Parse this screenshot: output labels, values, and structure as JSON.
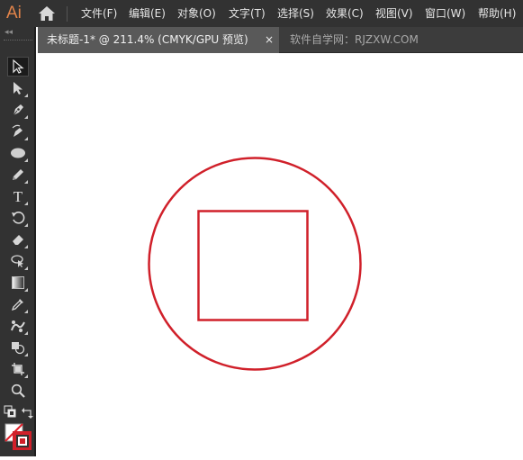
{
  "app": {
    "logo_text": "Ai",
    "brand_color": "#e2844a"
  },
  "menu": {
    "items": [
      {
        "label": "文件(F)"
      },
      {
        "label": "编辑(E)"
      },
      {
        "label": "对象(O)"
      },
      {
        "label": "文字(T)"
      },
      {
        "label": "选择(S)"
      },
      {
        "label": "效果(C)"
      },
      {
        "label": "视图(V)"
      },
      {
        "label": "窗口(W)"
      },
      {
        "label": "帮助(H)"
      }
    ]
  },
  "tabs": {
    "active": {
      "label": "未标题-1* @ 211.4% (CMYK/GPU 预览)",
      "close": "×"
    },
    "secondary": {
      "label": "软件自学网：RJZXW.COM"
    }
  },
  "toolbar": {
    "header": "◂◂",
    "tools": [
      {
        "icon": "selection-tool-icon"
      },
      {
        "icon": "direct-selection-tool-icon"
      },
      {
        "icon": "pen-tool-icon"
      },
      {
        "icon": "curvature-tool-icon"
      },
      {
        "icon": "ellipse-tool-icon"
      },
      {
        "icon": "pencil-tool-icon"
      },
      {
        "icon": "type-tool-icon",
        "glyph": "T"
      },
      {
        "icon": "rotate-tool-icon"
      },
      {
        "icon": "eraser-tool-icon"
      },
      {
        "icon": "lasso-tool-icon"
      },
      {
        "icon": "gradient-tool-icon"
      },
      {
        "icon": "eyedropper-tool-icon"
      },
      {
        "icon": "puppet-warp-tool-icon"
      },
      {
        "icon": "shape-builder-tool-icon"
      },
      {
        "icon": "artboard-tool-icon"
      },
      {
        "icon": "zoom-tool-icon"
      }
    ]
  },
  "colors": {
    "stroke": "#d0202a",
    "ui_dark": "#323232",
    "tab_active": "#595959"
  },
  "artwork": {
    "shapes": [
      "circle",
      "square"
    ]
  }
}
